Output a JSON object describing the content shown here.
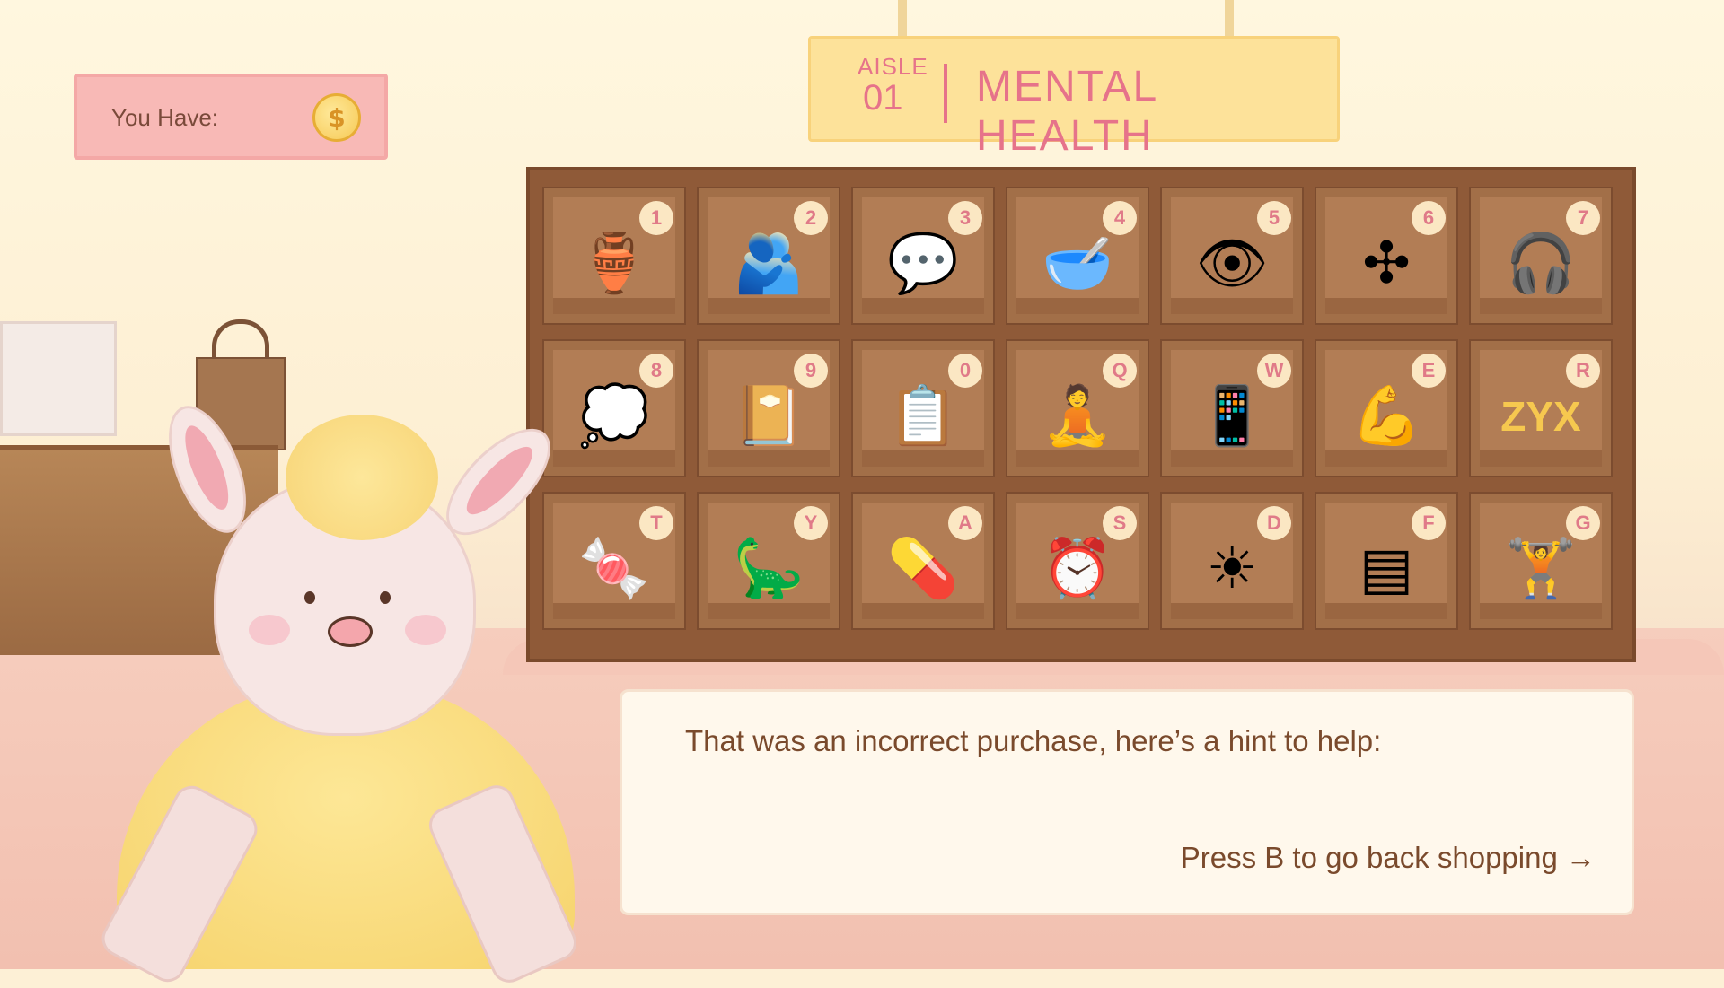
{
  "wallet": {
    "label": "You Have:",
    "coin_icon": "coin-icon"
  },
  "sign": {
    "aisle_label": "AISLE",
    "aisle_number": "01",
    "title": "MENTAL HEALTH"
  },
  "shelf": {
    "items": [
      {
        "key": "1",
        "icon": "diffuser-icon",
        "glyph": "🏺"
      },
      {
        "key": "2",
        "icon": "friends-hug-icon",
        "glyph": "🫂"
      },
      {
        "key": "3",
        "icon": "therapy-speech-bubble-icon",
        "glyph": "💬"
      },
      {
        "key": "4",
        "icon": "person-cooking-icon",
        "glyph": "🥣"
      },
      {
        "key": "5",
        "icon": "eye-icon",
        "glyph": "👁"
      },
      {
        "key": "6",
        "icon": "fidget-spinner-icon",
        "glyph": "✣"
      },
      {
        "key": "7",
        "icon": "headphones-icon",
        "glyph": "🎧"
      },
      {
        "key": "8",
        "icon": "sad-thought-bubble-icon",
        "glyph": "💭"
      },
      {
        "key": "9",
        "icon": "journal-icon",
        "glyph": "📔"
      },
      {
        "key": "0",
        "icon": "meal-plan-icon",
        "glyph": "📋"
      },
      {
        "key": "Q",
        "icon": "meditation-icon",
        "glyph": "🧘"
      },
      {
        "key": "W",
        "icon": "phone-app-icon",
        "glyph": "📱"
      },
      {
        "key": "E",
        "icon": "flexed-arm-icon",
        "glyph": "💪"
      },
      {
        "key": "R",
        "icon": "zyx-letters-icon",
        "glyph": "ZYX"
      },
      {
        "key": "T",
        "icon": "candy-icon",
        "glyph": "🍬"
      },
      {
        "key": "Y",
        "icon": "dinosaur-icon",
        "glyph": "🦕"
      },
      {
        "key": "A",
        "icon": "ssri-pills-icon",
        "glyph": "💊"
      },
      {
        "key": "S",
        "icon": "alarm-clock-icon",
        "glyph": "⏰"
      },
      {
        "key": "D",
        "icon": "sun-icon",
        "glyph": "☀"
      },
      {
        "key": "F",
        "icon": "pillow-icon",
        "glyph": "▤"
      },
      {
        "key": "G",
        "icon": "dumbbell-icon",
        "glyph": "🏋"
      }
    ]
  },
  "dialog": {
    "message": "That was an incorrect purchase, here’s a hint to help:",
    "cta": "Press B to go back shopping →"
  },
  "colors": {
    "accent_pink": "#e6738a",
    "shelf_brown": "#8f5a38",
    "text_brown": "#7a4a2c",
    "sign_yellow": "#fde29a"
  }
}
